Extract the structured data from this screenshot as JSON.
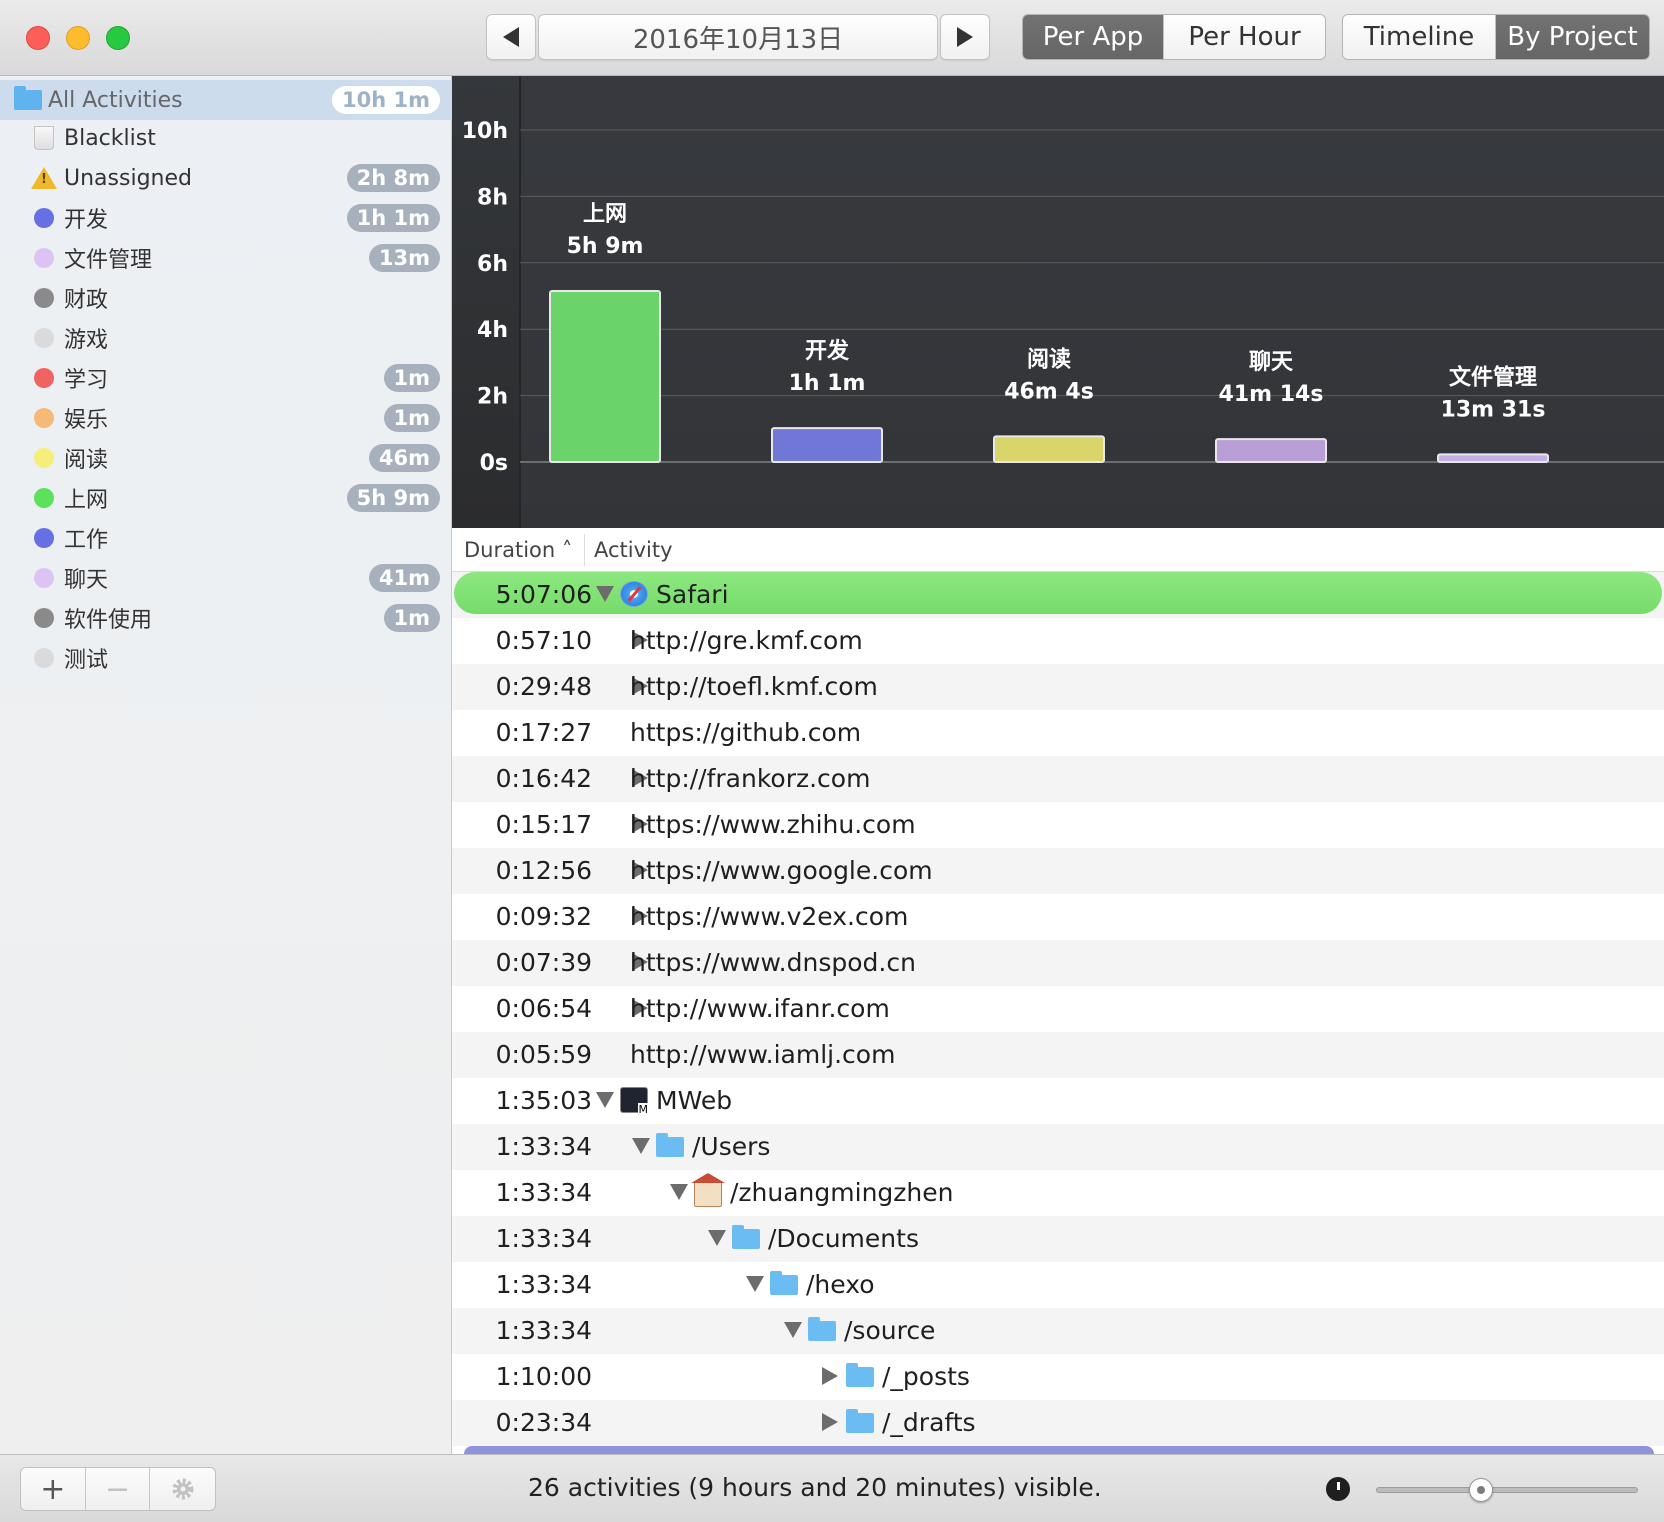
{
  "toolbar": {
    "date": "2016年10月13日",
    "mode_tabs": [
      {
        "label": "Per App",
        "selected": true
      },
      {
        "label": "Per Hour",
        "selected": false
      }
    ],
    "view_tabs": [
      {
        "label": "Timeline",
        "selected": false
      },
      {
        "label": "By Project",
        "selected": true
      }
    ]
  },
  "sidebar": {
    "items": [
      {
        "label": "All Activities",
        "badge": "10h 1m",
        "icon": "folder-icon",
        "selected": true
      },
      {
        "label": "Blacklist",
        "badge": "",
        "icon": "trash-icon"
      },
      {
        "label": "Unassigned",
        "badge": "2h 8m",
        "icon": "warning-icon"
      },
      {
        "label": "开发",
        "badge": "1h 1m",
        "color": "#6670e3"
      },
      {
        "label": "文件管理",
        "badge": "13m",
        "color": "#ddc3f4"
      },
      {
        "label": "财政",
        "badge": "",
        "color": "#8a8a8a"
      },
      {
        "label": "游戏",
        "badge": "",
        "color": "#dadada"
      },
      {
        "label": "学习",
        "badge": "1m",
        "color": "#f06363"
      },
      {
        "label": "娱乐",
        "badge": "1m",
        "color": "#f7b977"
      },
      {
        "label": "阅读",
        "badge": "46m",
        "color": "#f5ef7a"
      },
      {
        "label": "上网",
        "badge": "5h 9m",
        "color": "#5de05b"
      },
      {
        "label": "工作",
        "badge": "",
        "color": "#6670e3"
      },
      {
        "label": "聊天",
        "badge": "41m",
        "color": "#ddc3f4"
      },
      {
        "label": "软件使用",
        "badge": "1m",
        "color": "#8a8a8a"
      },
      {
        "label": "测试",
        "badge": "",
        "color": "#dadada"
      }
    ]
  },
  "chart_data": {
    "type": "bar",
    "y_tick_labels": [
      "0s",
      "2h",
      "4h",
      "6h",
      "8h",
      "10h"
    ],
    "ylim": [
      0,
      10
    ],
    "grid": true,
    "bars": [
      {
        "category": "上网",
        "value_label": "5h 9m",
        "value_hours": 5.15,
        "color": "#6ad46b"
      },
      {
        "category": "开发",
        "value_label": "1h 1m",
        "value_hours": 1.02,
        "color": "#7177d6"
      },
      {
        "category": "阅读",
        "value_label": "46m 4s",
        "value_hours": 0.77,
        "color": "#d9d56a"
      },
      {
        "category": "聊天",
        "value_label": "41m 14s",
        "value_hours": 0.69,
        "color": "#b99fd6"
      },
      {
        "category": "文件管理",
        "value_label": "13m 31s",
        "value_hours": 0.23,
        "color": "#c4b0e6"
      }
    ]
  },
  "table": {
    "headers": {
      "duration": "Duration",
      "activity": "Activity"
    },
    "rows": [
      {
        "duration": "5:07:06",
        "activity": "Safari",
        "level": 0,
        "disclosure": "open",
        "icon": "safari-icon",
        "highlighted": true
      },
      {
        "duration": "0:57:10",
        "activity": "http://gre.kmf.com",
        "level": 1,
        "disclosure": "closed"
      },
      {
        "duration": "0:29:48",
        "activity": "http://toefl.kmf.com",
        "level": 1,
        "disclosure": "closed"
      },
      {
        "duration": "0:17:27",
        "activity": "https://github.com",
        "level": 1,
        "disclosure": "none"
      },
      {
        "duration": "0:16:42",
        "activity": "http://frankorz.com",
        "level": 1,
        "disclosure": "closed"
      },
      {
        "duration": "0:15:17",
        "activity": "https://www.zhihu.com",
        "level": 1,
        "disclosure": "closed"
      },
      {
        "duration": "0:12:56",
        "activity": "https://www.google.com",
        "level": 1,
        "disclosure": "closed"
      },
      {
        "duration": "0:09:32",
        "activity": "https://www.v2ex.com",
        "level": 1,
        "disclosure": "closed"
      },
      {
        "duration": "0:07:39",
        "activity": "https://www.dnspod.cn",
        "level": 1,
        "disclosure": "closed"
      },
      {
        "duration": "0:06:54",
        "activity": "http://www.ifanr.com",
        "level": 1,
        "disclosure": "closed"
      },
      {
        "duration": "0:05:59",
        "activity": "http://www.iamlj.com",
        "level": 1,
        "disclosure": "none"
      },
      {
        "duration": "1:35:03",
        "activity": "MWeb",
        "level": 0,
        "disclosure": "open",
        "icon": "mweb-icon"
      },
      {
        "duration": "1:33:34",
        "activity": "/Users",
        "level": 1,
        "disclosure": "open",
        "icon": "users-folder-icon"
      },
      {
        "duration": "1:33:34",
        "activity": "/zhuangmingzhen",
        "level": 2,
        "disclosure": "open",
        "icon": "home-icon"
      },
      {
        "duration": "1:33:34",
        "activity": "/Documents",
        "level": 3,
        "disclosure": "open",
        "icon": "documents-folder-icon"
      },
      {
        "duration": "1:33:34",
        "activity": "/hexo",
        "level": 4,
        "disclosure": "open",
        "icon": "folder-icon"
      },
      {
        "duration": "1:33:34",
        "activity": "/source",
        "level": 5,
        "disclosure": "open",
        "icon": "folder-icon"
      },
      {
        "duration": "1:10:00",
        "activity": "/_posts",
        "level": 6,
        "disclosure": "closed",
        "icon": "folder-icon"
      },
      {
        "duration": "0:23:34",
        "activity": "/_drafts",
        "level": 6,
        "disclosure": "closed",
        "icon": "folder-icon"
      }
    ]
  },
  "footer": {
    "add_label": "+",
    "remove_label": "−",
    "settings_icon": "gear-icon",
    "status": "26 activities (9 hours and 20 minutes) visible.",
    "zoom_fraction": 0.4
  }
}
